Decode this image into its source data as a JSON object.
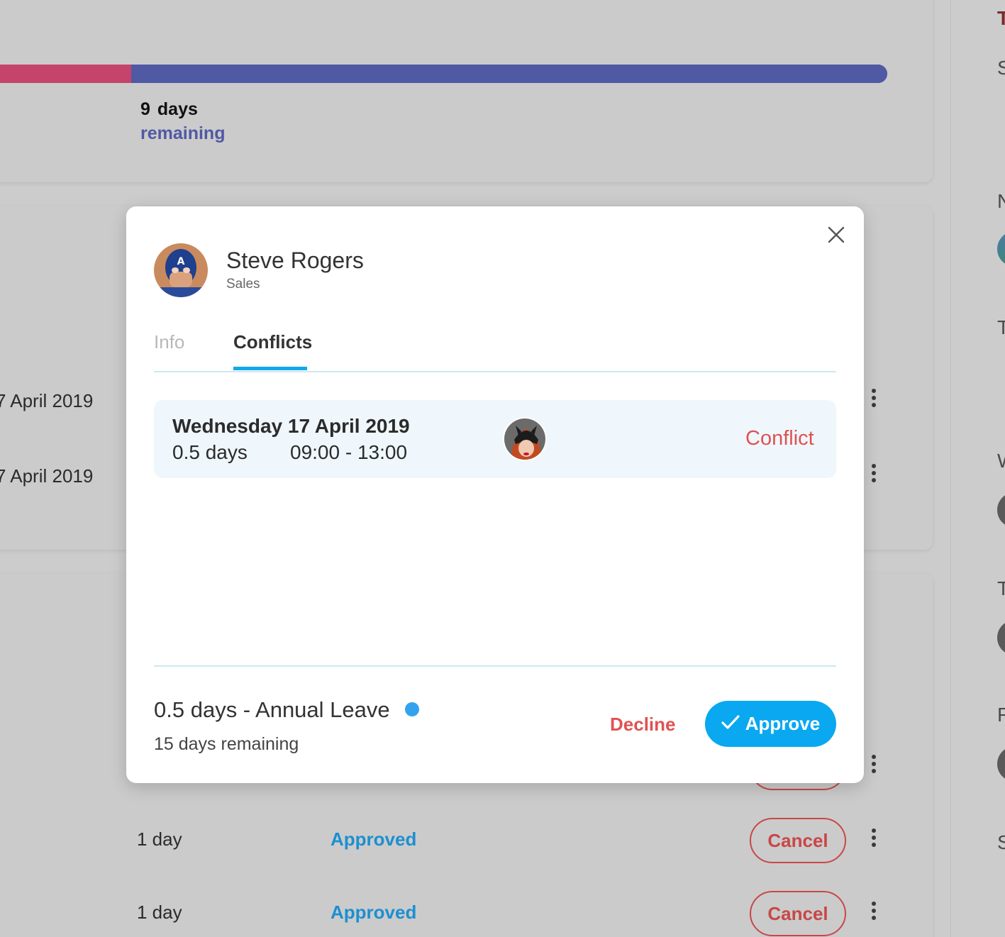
{
  "background": {
    "usage": {
      "used_fraction": 0.148,
      "days": "9",
      "days_label": "days",
      "remaining_label": "remaining"
    },
    "dates": [
      "7 April 2019",
      "7 April 2019"
    ],
    "rows": [
      {
        "days": "1 day",
        "status": "Approved",
        "action": "Cancel"
      },
      {
        "days": "1 day",
        "status": "Approved",
        "action": "Cancel"
      }
    ],
    "right_letters": [
      "T",
      "S",
      "N",
      "T",
      "W",
      "T",
      "F",
      "S"
    ]
  },
  "modal": {
    "user": {
      "name": "Steve Rogers",
      "department": "Sales"
    },
    "tabs": [
      {
        "label": "Info",
        "active": false
      },
      {
        "label": "Conflicts",
        "active": true
      }
    ],
    "conflict": {
      "date": "Wednesday 17 April 2019",
      "days": "0.5 days",
      "time": "09:00 - 13:00",
      "status": "Conflict"
    },
    "request": {
      "summary": "0.5 days - Annual Leave",
      "remaining": "15 days remaining",
      "dot_color": "#33a3ee"
    },
    "actions": {
      "decline": "Decline",
      "approve": "Approve"
    }
  },
  "colors": {
    "accent": "#09a8f0",
    "danger": "#e05252",
    "usage_used": "#c4446c",
    "usage_remaining": "#5059a4",
    "approved": "#1d8fd0"
  }
}
